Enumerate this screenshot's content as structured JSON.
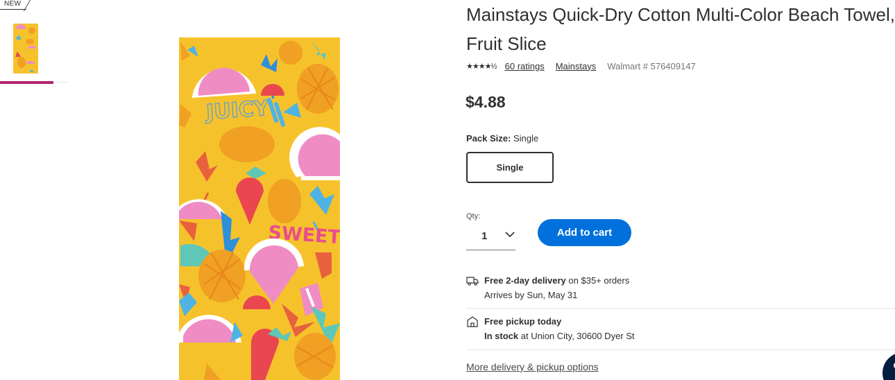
{
  "badge": {
    "new_label": "NEW"
  },
  "product": {
    "title_line1": "Mainstays Quick-Dry Cotton Multi-Color Beach Towel,",
    "title_line2": "Fruit Slice",
    "stars_text": "★★★★½",
    "ratings_link": "60 ratings",
    "brand_link": "Mainstays",
    "walmart_number": "Walmart # 576409147",
    "price": "$4.88"
  },
  "pack": {
    "label": "Pack Size:",
    "value": "Single",
    "option_label": "Single"
  },
  "quantity": {
    "label": "Qty:",
    "value": "1"
  },
  "cart": {
    "add_label": "Add to cart"
  },
  "fulfillment": {
    "delivery_title": "Free 2-day delivery",
    "delivery_suffix": " on $35+ orders",
    "delivery_eta": "Arrives by Sun, May 31",
    "pickup_title": "Free pickup today",
    "pickup_stock": "In stock",
    "pickup_location": " at Union City, 30600 Dyer St",
    "more_options": "More delivery & pickup options"
  },
  "image_text": {
    "word1": "JUICY",
    "word2": "SWEET"
  },
  "colors": {
    "accent_blue": "#0071dc",
    "thumb_underline": "#b0266e",
    "towel_yellow": "#f6c22c"
  },
  "icons": [
    "chevron-down-icon",
    "truck-icon",
    "store-icon",
    "chat-help-icon"
  ]
}
